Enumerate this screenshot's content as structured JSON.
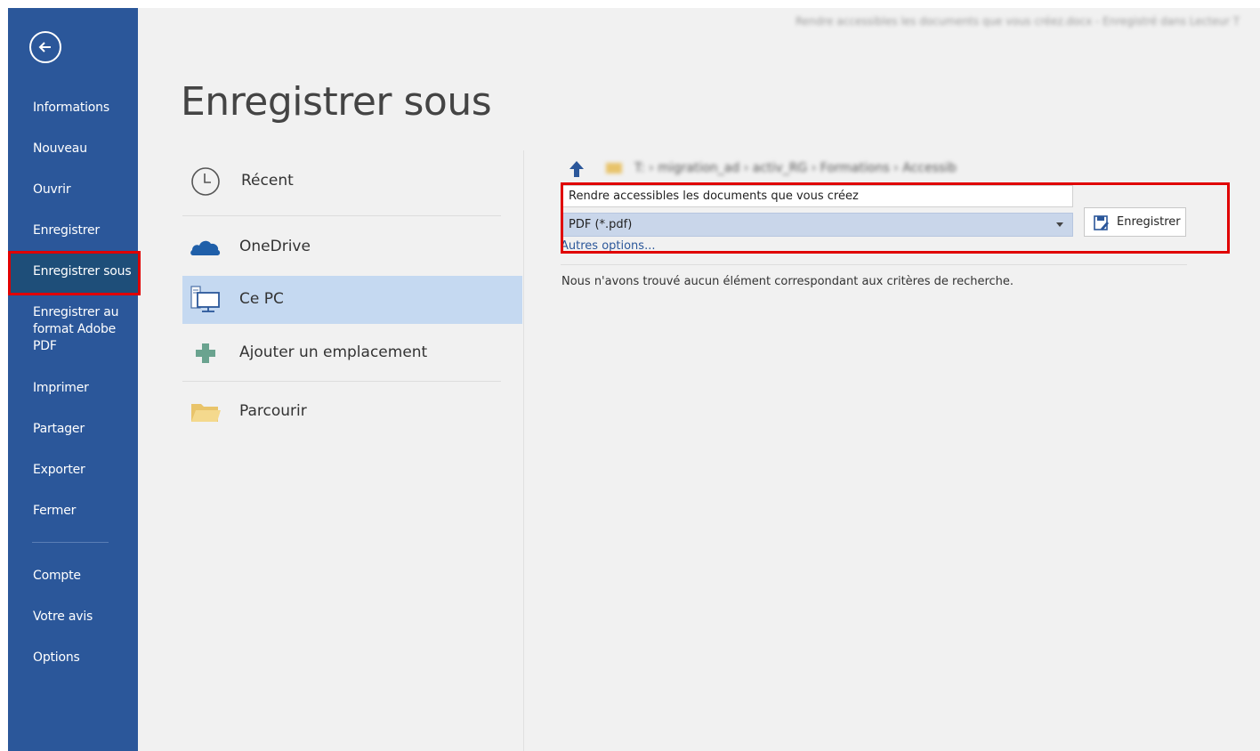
{
  "window": {
    "title": "Rendre accessibles les documents que vous créez.docx - Enregistré dans Lecteur T"
  },
  "sidebar": {
    "back_icon": "back-arrow-circle-icon",
    "items": [
      {
        "label": "Informations"
      },
      {
        "label": "Nouveau"
      },
      {
        "label": "Ouvrir"
      },
      {
        "label": "Enregistrer"
      },
      {
        "label": "Enregistrer sous",
        "active": true
      },
      {
        "label": "Enregistrer au format Adobe PDF"
      },
      {
        "label": "Imprimer"
      },
      {
        "label": "Partager"
      },
      {
        "label": "Exporter"
      },
      {
        "label": "Fermer"
      },
      {
        "label": "Compte"
      },
      {
        "label": "Votre avis"
      },
      {
        "label": "Options"
      }
    ],
    "color": "#2b579a"
  },
  "page": {
    "title": "Enregistrer sous"
  },
  "locations": [
    {
      "label": "Récent",
      "icon": "clock-icon"
    },
    {
      "label": "OneDrive",
      "icon": "cloud-icon"
    },
    {
      "label": "Ce PC",
      "icon": "computer-icon",
      "active": true
    },
    {
      "label": "Ajouter un emplacement",
      "icon": "plus-icon"
    },
    {
      "label": "Parcourir",
      "icon": "folder-icon"
    }
  ],
  "browser": {
    "breadcrumb": "T: › migration_ad › activ_RG › Formations › Accessib",
    "filename": "Rendre accessibles les documents que vous créez",
    "filetype": "PDF (*.pdf)",
    "more_options": "Autres options...",
    "save_label": "Enregistrer",
    "empty_message": "Nous n'avons trouvé aucun élément correspondant aux critères de recherche."
  },
  "highlight_color": "#e00000"
}
